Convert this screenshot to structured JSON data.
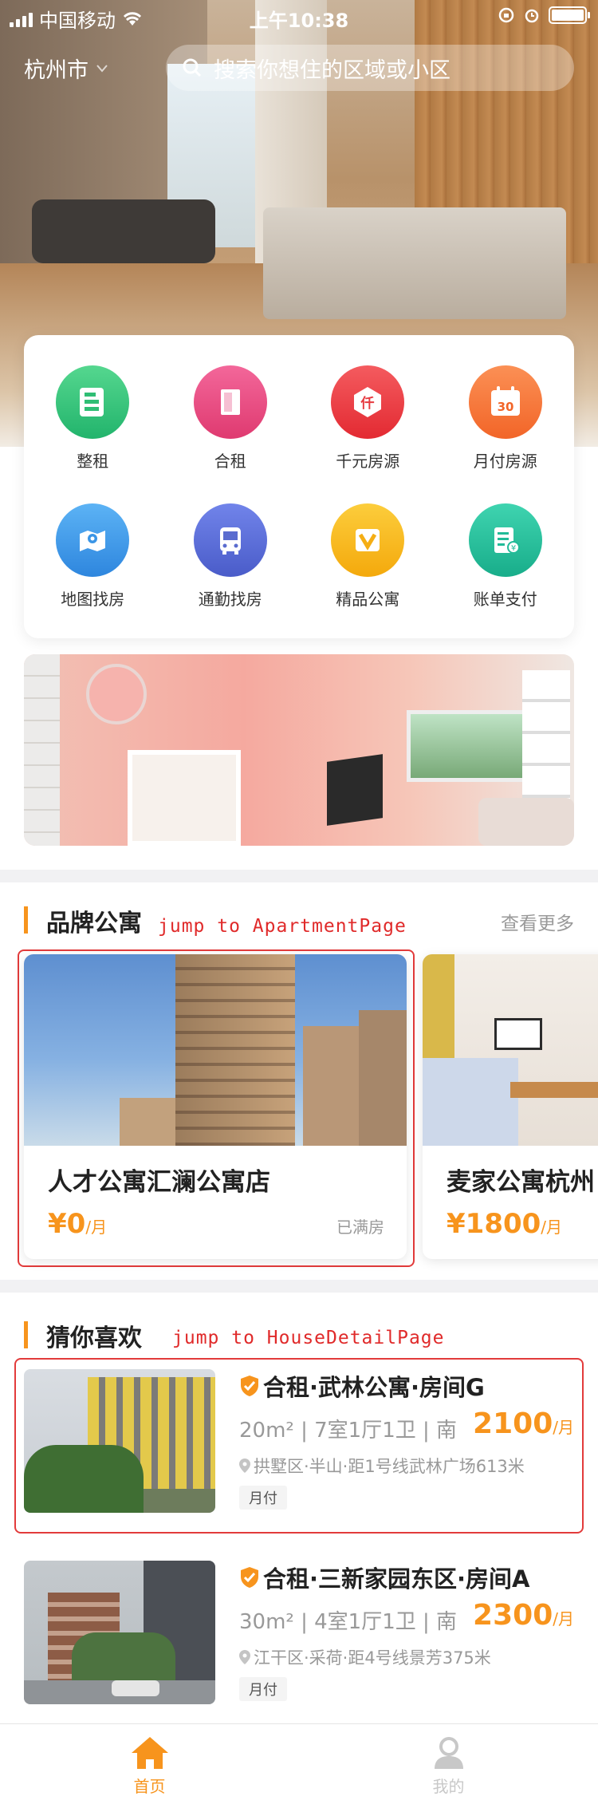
{
  "status_bar": {
    "carrier": "中国移动",
    "time": "上午10:38"
  },
  "header": {
    "city": "杭州市",
    "search_placeholder": "搜索你想住的区域或小区"
  },
  "categories": [
    {
      "label": "整租",
      "icon": "apartment-doc-icon",
      "color": "#34c37d"
    },
    {
      "label": "合租",
      "icon": "door-icon",
      "color": "#e9487f"
    },
    {
      "label": "千元房源",
      "icon": "price-tag-icon",
      "color": "#ee3b42"
    },
    {
      "label": "月付房源",
      "icon": "calendar-icon",
      "color": "#f8773c"
    },
    {
      "label": "地图找房",
      "icon": "map-icon",
      "color": "#3d9be9"
    },
    {
      "label": "通勤找房",
      "icon": "bus-icon",
      "color": "#5b6fd6"
    },
    {
      "label": "精品公寓",
      "icon": "v-badge-icon",
      "color": "#f7b81e"
    },
    {
      "label": "账单支付",
      "icon": "bill-icon",
      "color": "#23bf9e"
    }
  ],
  "calendar_number": "30",
  "brand_section": {
    "title": "品牌公寓",
    "more": "查看更多",
    "annotation": "jump to ApartmentPage",
    "apartments": [
      {
        "name": "人才公寓汇澜公寓店",
        "price": "¥0",
        "unit": "/月",
        "status": "已满房"
      },
      {
        "name": "麦家公寓杭州",
        "price": "¥1800",
        "unit": "/月",
        "status": ""
      }
    ]
  },
  "guess_section": {
    "title": "猜你喜欢",
    "annotation": "jump to HouseDetailPage",
    "houses": [
      {
        "title": "合租·武林公寓·房间G",
        "spec": "20m² | 7室1厅1卫 | 南",
        "price": "2100",
        "unit": "/月",
        "location": "拱墅区·半山·距1号线武林广场613米",
        "tag": "月付"
      },
      {
        "title": "合租·三新家园东区·房间A",
        "spec": "30m² | 4室1厅1卫 | 南",
        "price": "2300",
        "unit": "/月",
        "location": "江干区·采荷·距4号线景芳375米",
        "tag": "月付"
      }
    ]
  },
  "tabbar": {
    "home": "首页",
    "mine": "我的",
    "active_color": "#f7941d",
    "inactive_color": "#c8c8c8"
  }
}
